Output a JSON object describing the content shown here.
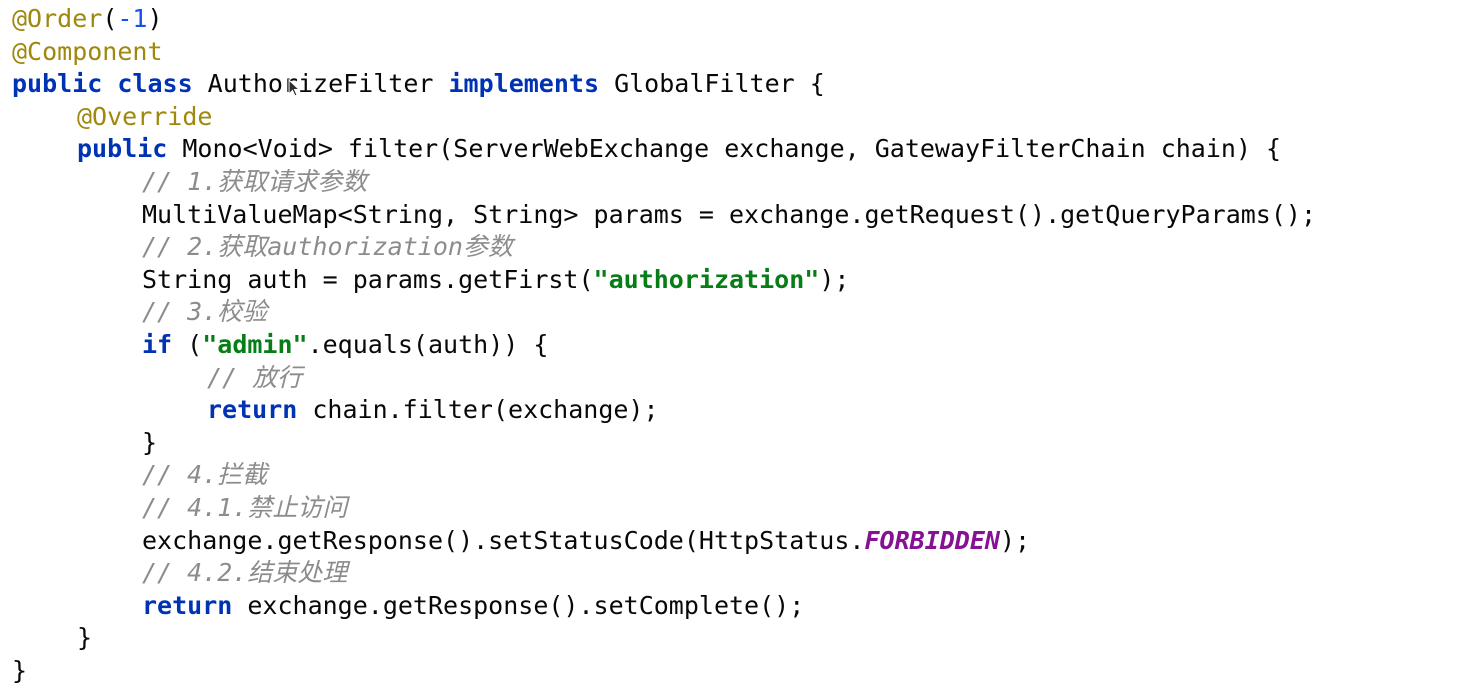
{
  "editor": {
    "colors": {
      "keyword": "#0033b3",
      "annotation": "#9e880d",
      "number": "#1750eb",
      "string": "#067d17",
      "comment": "#8c8c8c",
      "constant": "#871094",
      "plain": "#080808",
      "background": "#ffffff"
    },
    "lines": [
      {
        "indent": 0,
        "tokens": [
          {
            "t": "annotation",
            "text": "@Order"
          },
          {
            "t": "plain",
            "text": "("
          },
          {
            "t": "number",
            "text": "-1"
          },
          {
            "t": "plain",
            "text": ")"
          }
        ]
      },
      {
        "indent": 0,
        "tokens": [
          {
            "t": "annotation",
            "text": "@Component"
          }
        ]
      },
      {
        "indent": 0,
        "tokens": [
          {
            "t": "keyword",
            "text": "public class "
          },
          {
            "t": "plain",
            "text": "AuthorizeFilter "
          },
          {
            "t": "keyword",
            "text": "implements "
          },
          {
            "t": "plain",
            "text": "GlobalFilter {"
          }
        ]
      },
      {
        "indent": 1,
        "tokens": [
          {
            "t": "annotation",
            "text": "@Override"
          }
        ]
      },
      {
        "indent": 1,
        "tokens": [
          {
            "t": "keyword",
            "text": "public "
          },
          {
            "t": "plain",
            "text": "Mono<Void> filter(ServerWebExchange exchange, GatewayFilterChain chain) {"
          }
        ]
      },
      {
        "indent": 2,
        "tokens": [
          {
            "t": "comment",
            "text": "// 1.获取请求参数"
          }
        ]
      },
      {
        "indent": 2,
        "tokens": [
          {
            "t": "plain",
            "text": "MultiValueMap<String, String> params = exchange.getRequest().getQueryParams();"
          }
        ]
      },
      {
        "indent": 2,
        "tokens": [
          {
            "t": "comment",
            "text": "// 2.获取authorization参数"
          }
        ]
      },
      {
        "indent": 2,
        "tokens": [
          {
            "t": "plain",
            "text": "String auth = params.getFirst("
          },
          {
            "t": "string",
            "text": "\"authorization\""
          },
          {
            "t": "plain",
            "text": ");"
          }
        ]
      },
      {
        "indent": 2,
        "tokens": [
          {
            "t": "comment",
            "text": "// 3.校验"
          }
        ]
      },
      {
        "indent": 2,
        "tokens": [
          {
            "t": "keyword",
            "text": "if "
          },
          {
            "t": "plain",
            "text": "("
          },
          {
            "t": "string",
            "text": "\"admin\""
          },
          {
            "t": "plain",
            "text": ".equals(auth)) {"
          }
        ]
      },
      {
        "indent": 3,
        "tokens": [
          {
            "t": "comment",
            "text": "// 放行"
          }
        ]
      },
      {
        "indent": 3,
        "tokens": [
          {
            "t": "keyword",
            "text": "return "
          },
          {
            "t": "plain",
            "text": "chain.filter(exchange);"
          }
        ]
      },
      {
        "indent": 2,
        "tokens": [
          {
            "t": "plain",
            "text": "}"
          }
        ]
      },
      {
        "indent": 2,
        "tokens": [
          {
            "t": "comment",
            "text": "// 4.拦截"
          }
        ]
      },
      {
        "indent": 2,
        "tokens": [
          {
            "t": "comment",
            "text": "// 4.1.禁止访问"
          }
        ]
      },
      {
        "indent": 2,
        "tokens": [
          {
            "t": "plain",
            "text": "exchange.getResponse().setStatusCode(HttpStatus."
          },
          {
            "t": "constant",
            "text": "FORBIDDEN"
          },
          {
            "t": "plain",
            "text": ");"
          }
        ]
      },
      {
        "indent": 2,
        "tokens": [
          {
            "t": "comment",
            "text": "// 4.2.结束处理"
          }
        ]
      },
      {
        "indent": 2,
        "tokens": [
          {
            "t": "keyword",
            "text": "return "
          },
          {
            "t": "plain",
            "text": "exchange.getResponse().setComplete();"
          }
        ]
      },
      {
        "indent": 1,
        "tokens": [
          {
            "t": "plain",
            "text": "}"
          }
        ]
      },
      {
        "indent": 0,
        "tokens": [
          {
            "t": "plain",
            "text": "}"
          }
        ]
      }
    ]
  }
}
